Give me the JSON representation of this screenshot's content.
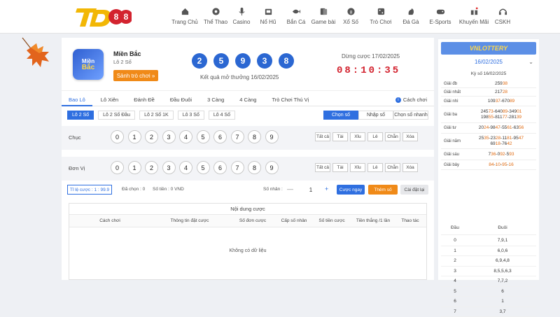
{
  "nav": {
    "items": [
      {
        "label": "Trang Chủ",
        "icon": "home-icon"
      },
      {
        "label": "Thể Thao",
        "icon": "ball-icon"
      },
      {
        "label": "Casino",
        "icon": "mic-icon"
      },
      {
        "label": "Nổ Hũ",
        "icon": "slot-icon"
      },
      {
        "label": "Bắn Cá",
        "icon": "fish-icon"
      },
      {
        "label": "Game bài",
        "icon": "cards-icon"
      },
      {
        "label": "Xổ Số",
        "icon": "lottery-icon"
      },
      {
        "label": "Trò Chơi",
        "icon": "dice-icon"
      },
      {
        "label": "Đá Gà",
        "icon": "rooster-icon"
      },
      {
        "label": "E-Sports",
        "icon": "gamepad-icon"
      },
      {
        "label": "Khuyến Mãi",
        "icon": "gift-icon"
      },
      {
        "label": "CSKH",
        "icon": "headset-icon"
      }
    ]
  },
  "hero": {
    "region_logo_line1": "Miền",
    "region_logo_line2": "Bắc",
    "region_name": "Miền Bắc",
    "region_sub": "Lô 2 Số",
    "play_btn": "Sảnh trò chơi »",
    "balls": [
      "2",
      "5",
      "9",
      "3",
      "8"
    ],
    "result_date": "Kết quả mở thưởng 16/02/2025",
    "stop_label": "Dừng cược 17/02/2025",
    "countdown": "08:10:35"
  },
  "tabs": [
    "Bao Lô",
    "Lô Xiên",
    "Đánh Đề",
    "Đầu Đuôi",
    "3 Càng",
    "4 Càng",
    "Trò Chơi Thú Vị"
  ],
  "howto": "Cách chơi",
  "subtabs": [
    "Lô 2 Số",
    "Lô 2 Số Đầu",
    "Lô 2 Số 1K",
    "Lô 3 Số",
    "Lô 4 Số"
  ],
  "modes": [
    "Chọn số",
    "Nhập số",
    "Chọn số nhanh"
  ],
  "rows": [
    {
      "label": "Chục",
      "digits": [
        "0",
        "1",
        "2",
        "3",
        "4",
        "5",
        "6",
        "7",
        "8",
        "9"
      ]
    },
    {
      "label": "Đơn Vị",
      "digits": [
        "0",
        "1",
        "2",
        "3",
        "4",
        "5",
        "6",
        "7",
        "8",
        "9"
      ]
    }
  ],
  "filters": [
    "Tất cả",
    "Tài",
    "Xỉu",
    "Lẻ",
    "Chẵn",
    "Xóa"
  ],
  "betbar": {
    "ratio": "Tỉ lệ cược : 1 : 99.9",
    "chosen": "Đã chọn : 0",
    "money": "Số tiền : 0 VND",
    "mult_label": "Số nhân :",
    "minus": "—",
    "mult": "1",
    "plus": "+",
    "btn_now": "Cược ngay",
    "btn_add": "Thêm số",
    "btn_reset": "Cài đặt lại"
  },
  "content": {
    "title": "Nội dung cược",
    "headers": [
      "Cách chơi",
      "Thông tin đặt cược",
      "Số đơn cược",
      "Cấp số nhân",
      "Số tiền cược",
      "Tiền thắng /1 lần",
      "Thao tác"
    ],
    "empty": "Không có dữ liệu"
  },
  "side": {
    "logo": "VNLOTTERY",
    "date": "16/02/2025",
    "ky": "Kỳ số 16/02/2025",
    "prizes": [
      {
        "name": "Giải đb",
        "lines": [
          [
            "259",
            "38"
          ]
        ]
      },
      {
        "name": "Giải nhất",
        "lines": [
          [
            "217",
            "28"
          ]
        ]
      },
      {
        "name": "Giải nhì",
        "lines": [
          [
            "109",
            "37",
            "-670",
            "89"
          ]
        ]
      },
      {
        "name": "Giải ba",
        "lines": [
          [
            "245",
            "73",
            "-640",
            "89",
            "-349",
            "01"
          ],
          [
            "198",
            "55",
            "-811",
            "77",
            "-281",
            "39"
          ]
        ]
      },
      {
        "name": "Giải tư",
        "lines": [
          [
            "20",
            "24",
            "-98",
            "47",
            "-55",
            "61",
            "-63",
            "56"
          ]
        ]
      },
      {
        "name": "Giải năm",
        "lines": [
          [
            "25",
            "35",
            "-23",
            "28",
            "-11",
            "81",
            "-95",
            "47"
          ],
          [
            "69",
            "18",
            "-76",
            "42"
          ]
        ]
      },
      {
        "name": "Giải sáu",
        "lines": [
          [
            "7",
            "36",
            "-0",
            "92",
            "-5",
            "93"
          ]
        ]
      },
      {
        "name": "Giải bảy",
        "lines": [
          [
            "",
            "84",
            "-",
            "10",
            "-",
            "95",
            "-",
            "16"
          ]
        ]
      }
    ],
    "dd_headers": [
      "Đầu",
      "Đuôi"
    ],
    "dd_rows": [
      [
        "0",
        "7,9,1"
      ],
      [
        "1",
        "6,0,6"
      ],
      [
        "2",
        "6,9,4,8"
      ],
      [
        "3",
        "8,5,5,6,3"
      ],
      [
        "4",
        "7,7,2"
      ],
      [
        "5",
        "6"
      ],
      [
        "6",
        "1"
      ],
      [
        "7",
        "3,7"
      ]
    ]
  }
}
